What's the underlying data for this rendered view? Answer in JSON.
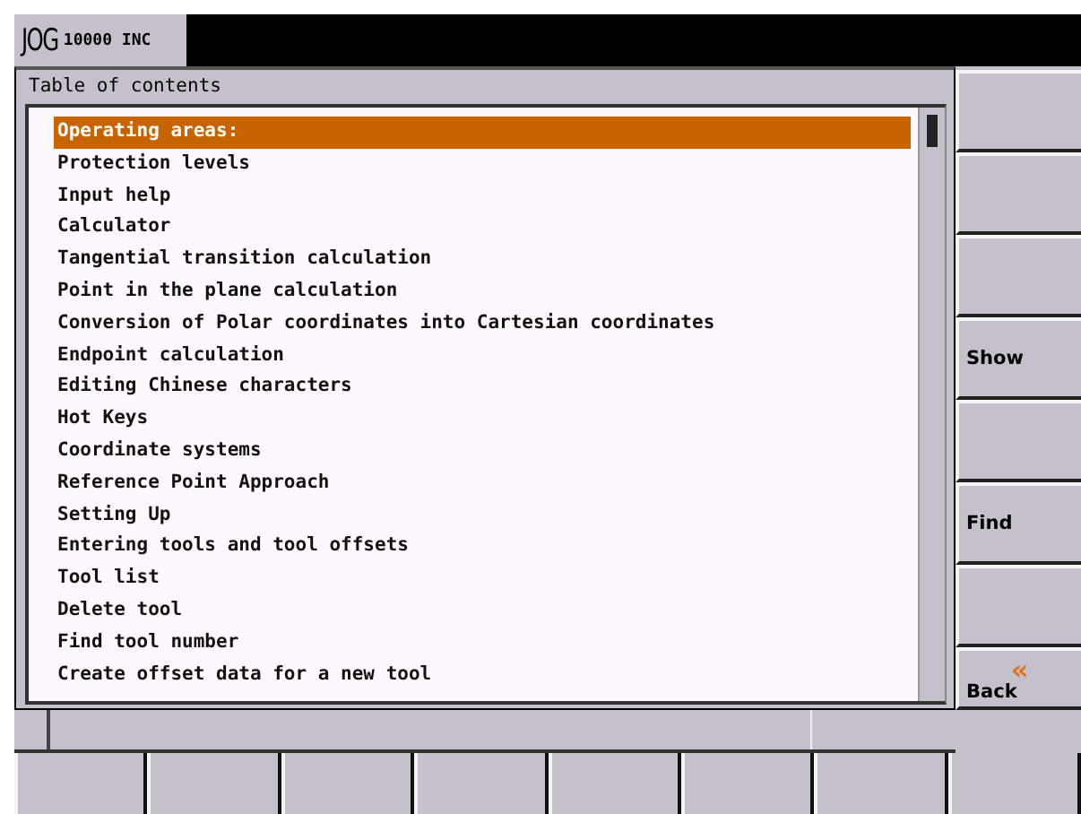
{
  "header": {
    "mode": "JOG",
    "increment": "10000 INC"
  },
  "panel": {
    "title": "Table of contents",
    "items": [
      {
        "label": "Operating areas:",
        "selected": true
      },
      {
        "label": "Protection levels",
        "selected": false
      },
      {
        "label": "Input help",
        "selected": false
      },
      {
        "label": "Calculator",
        "selected": false
      },
      {
        "label": "Tangential transition calculation",
        "selected": false
      },
      {
        "label": "Point in the plane calculation",
        "selected": false
      },
      {
        "label": "Conversion of Polar coordinates into Cartesian coordinates",
        "selected": false
      },
      {
        "label": "Endpoint calculation",
        "selected": false
      },
      {
        "label": "Editing Chinese characters",
        "selected": false
      },
      {
        "label": "Hot Keys",
        "selected": false
      },
      {
        "label": "Coordinate systems",
        "selected": false
      },
      {
        "label": "Reference Point Approach",
        "selected": false
      },
      {
        "label": "Setting Up",
        "selected": false
      },
      {
        "label": "Entering tools and tool offsets",
        "selected": false
      },
      {
        "label": "Tool list",
        "selected": false
      },
      {
        "label": "Delete tool",
        "selected": false
      },
      {
        "label": "Find tool number",
        "selected": false
      },
      {
        "label": "Create offset data for a new tool",
        "selected": false
      }
    ]
  },
  "vertical_softkeys": [
    {
      "kind": "blank"
    },
    {
      "kind": "blank"
    },
    {
      "kind": "blank"
    },
    {
      "kind": "labeled",
      "label": "Show"
    },
    {
      "kind": "blank"
    },
    {
      "kind": "labeled",
      "label": "Find"
    },
    {
      "kind": "blank"
    },
    {
      "kind": "labeled",
      "label": "Back",
      "icon": "«"
    }
  ],
  "horizontal_softkeys": [
    {
      "kind": "blank"
    },
    {
      "kind": "blank"
    },
    {
      "kind": "blank"
    },
    {
      "kind": "blank"
    },
    {
      "kind": "blank"
    },
    {
      "kind": "blank"
    },
    {
      "kind": "blank"
    },
    {
      "kind": "blank"
    }
  ]
}
